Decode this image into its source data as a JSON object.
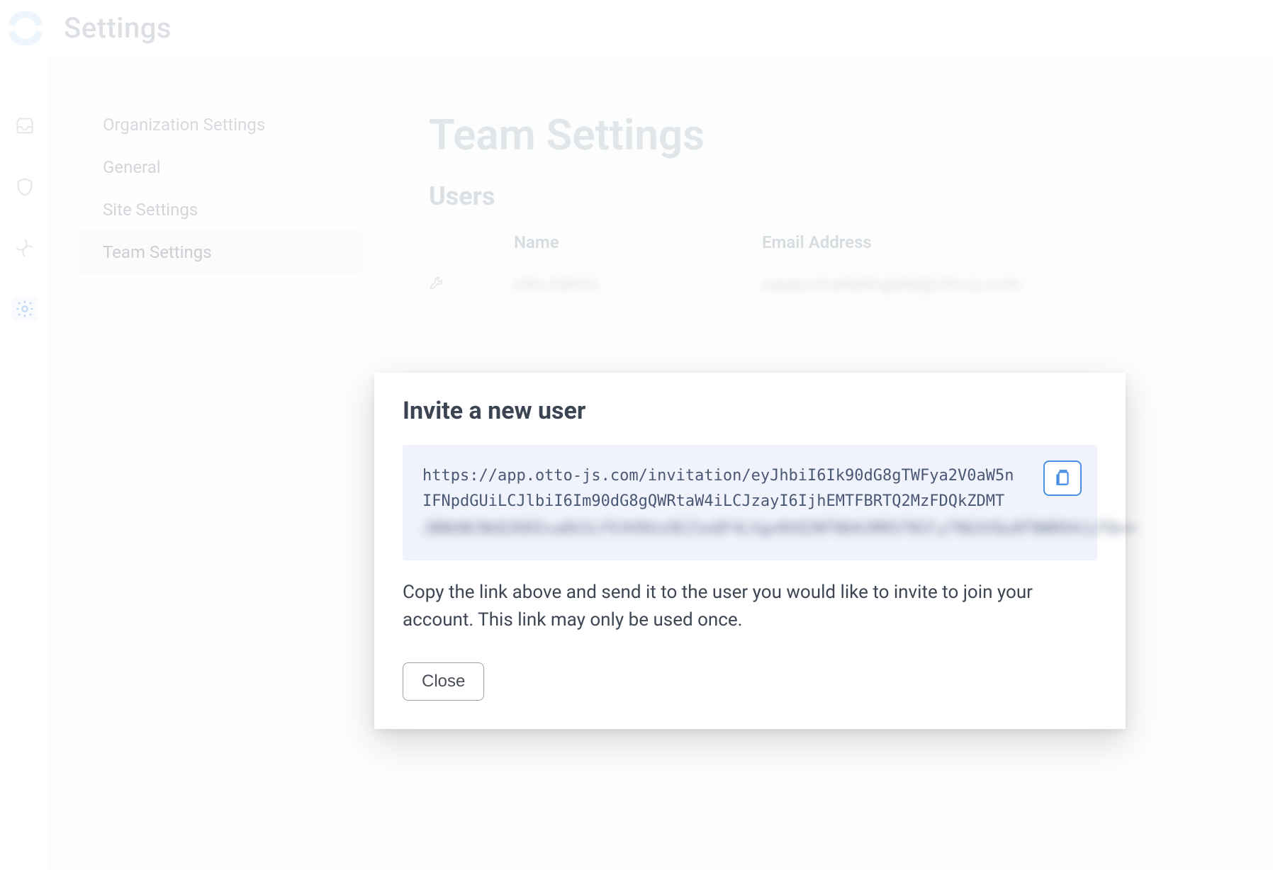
{
  "header": {
    "title": "Settings"
  },
  "rail": {
    "items": [
      {
        "name": "inbox-icon"
      },
      {
        "name": "shield-icon"
      },
      {
        "name": "swirl-icon"
      },
      {
        "name": "gear-icon",
        "active": true
      }
    ]
  },
  "sidebar": {
    "items": [
      {
        "label": "Organization Settings",
        "heading": true
      },
      {
        "label": "General"
      },
      {
        "label": "Site Settings"
      },
      {
        "label": "Team Settings",
        "active": true
      }
    ]
  },
  "main": {
    "title": "Team Settings",
    "section": "Users",
    "columns": {
      "name": "Name",
      "email": "Email Address"
    },
    "rows": [
      {
        "name": "otto Admin",
        "email": "casey+marketingsite@otto-js.com"
      }
    ]
  },
  "modal": {
    "title": "Invite a new user",
    "link_visible": "https://app.otto-js.com/invitation/eyJhbiI6Ik90dG8gTWFya2V0aW5nIFNpdGUiLCJlbiI6Im90dG8gQWRtaW4iLCJzayI6IjhEMTFBRTQ2MzFDQkZDMT",
    "link_obscured": "JBNUNCNUQ3OEExa0U1LFE4VDUzOEZ1eQF4LXgnRXQ3NTNOA3MDSTN3lyTNGXXQuNTNNRO4iLFQ==",
    "description": "Copy the link above and send it to the user you would like to invite to join your account. This link may only be used once.",
    "close_label": "Close"
  }
}
